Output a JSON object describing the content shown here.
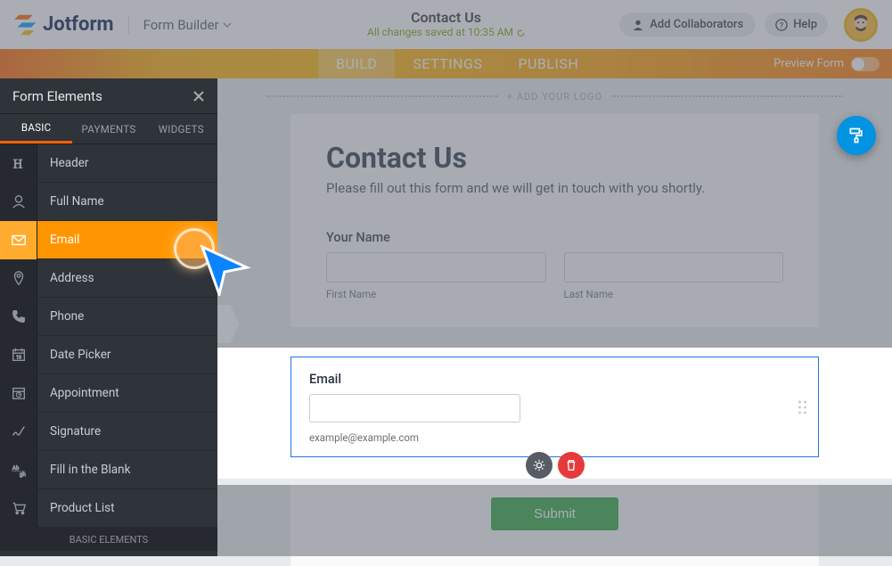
{
  "header": {
    "brand": "Jotform",
    "dropdown_label": "Form Builder",
    "form_title": "Contact Us",
    "saved_status": "All changes saved at 10:35 AM",
    "add_collab_label": "Add Collaborators",
    "help_label": "Help"
  },
  "nav": {
    "tabs": [
      "BUILD",
      "SETTINGS",
      "PUBLISH"
    ],
    "preview_label": "Preview Form"
  },
  "sidebar": {
    "title": "Form Elements",
    "tabs": [
      "BASIC",
      "PAYMENTS",
      "WIDGETS"
    ],
    "footer": "BASIC ELEMENTS",
    "items": [
      {
        "label": "Header",
        "icon": "heading-icon"
      },
      {
        "label": "Full Name",
        "icon": "user-icon"
      },
      {
        "label": "Email",
        "icon": "mail-icon",
        "active": true
      },
      {
        "label": "Address",
        "icon": "pin-icon"
      },
      {
        "label": "Phone",
        "icon": "phone-icon"
      },
      {
        "label": "Date Picker",
        "icon": "calendar-icon"
      },
      {
        "label": "Appointment",
        "icon": "schedule-icon"
      },
      {
        "label": "Signature",
        "icon": "signature-icon"
      },
      {
        "label": "Fill in the Blank",
        "icon": "blank-icon"
      },
      {
        "label": "Product List",
        "icon": "cart-icon"
      }
    ]
  },
  "canvas": {
    "add_logo_label": "+ ADD YOUR LOGO",
    "form_heading": "Contact Us",
    "form_sub": "Please fill out this form and we will get in touch with you shortly.",
    "name_label": "Your Name",
    "first_name_label": "First Name",
    "last_name_label": "Last Name",
    "email_label": "Email",
    "email_example": "example@example.com",
    "submit_label": "Submit"
  }
}
